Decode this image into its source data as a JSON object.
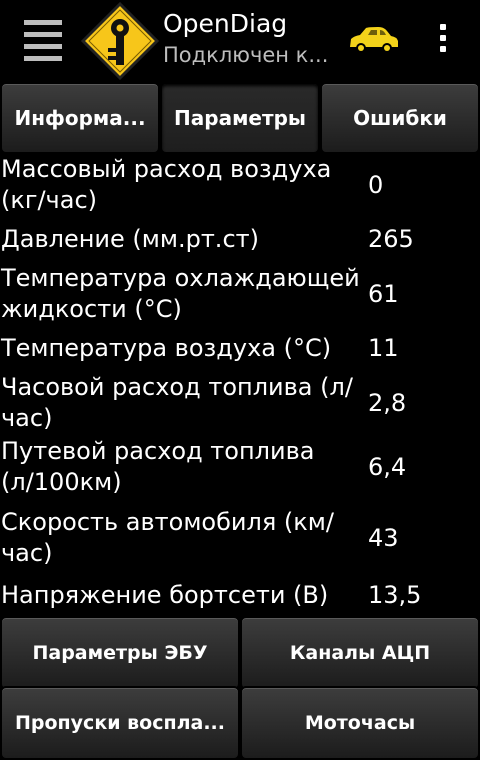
{
  "actionbar": {
    "title": "OpenDiag",
    "subtitle": "Подключен к..."
  },
  "tabs": [
    {
      "label": "Информа...",
      "selected": false
    },
    {
      "label": "Параметры",
      "selected": true
    },
    {
      "label": "Ошибки",
      "selected": false
    }
  ],
  "params": [
    {
      "name": "Массовый расход воздуха (кг/час)",
      "value": "0"
    },
    {
      "name": "Давление (мм.рт.ст)",
      "value": "265"
    },
    {
      "name": "Температура охлаждающей жидкости (°С)",
      "value": "61"
    },
    {
      "name": "Температура воздуха (°С)",
      "value": "11"
    },
    {
      "name": "Часовой расход топлива (л/час)",
      "value": "2,8"
    },
    {
      "name": "Путевой расход топлива (л/100км)",
      "value": "6,4"
    },
    {
      "name": "Скорость автомобиля (км/час)",
      "value": "43"
    },
    {
      "name": "Напряжение бортсети (В)",
      "value": "13,5"
    }
  ],
  "bottom_buttons": [
    {
      "label": "Параметры ЭБУ"
    },
    {
      "label": "Каналы АЦП"
    },
    {
      "label": "Пропуски воспла..."
    },
    {
      "label": "Моточасы"
    }
  ],
  "colors": {
    "logo_yellow": "#f7c61a",
    "car_yellow": "#f3d21a",
    "background": "#000000",
    "subtitle_gray": "#bdbdbd"
  },
  "icons": {
    "menu": "hamburger-icon",
    "logo": "key-diamond-icon",
    "car": "car-icon",
    "overflow": "overflow-menu-icon"
  }
}
